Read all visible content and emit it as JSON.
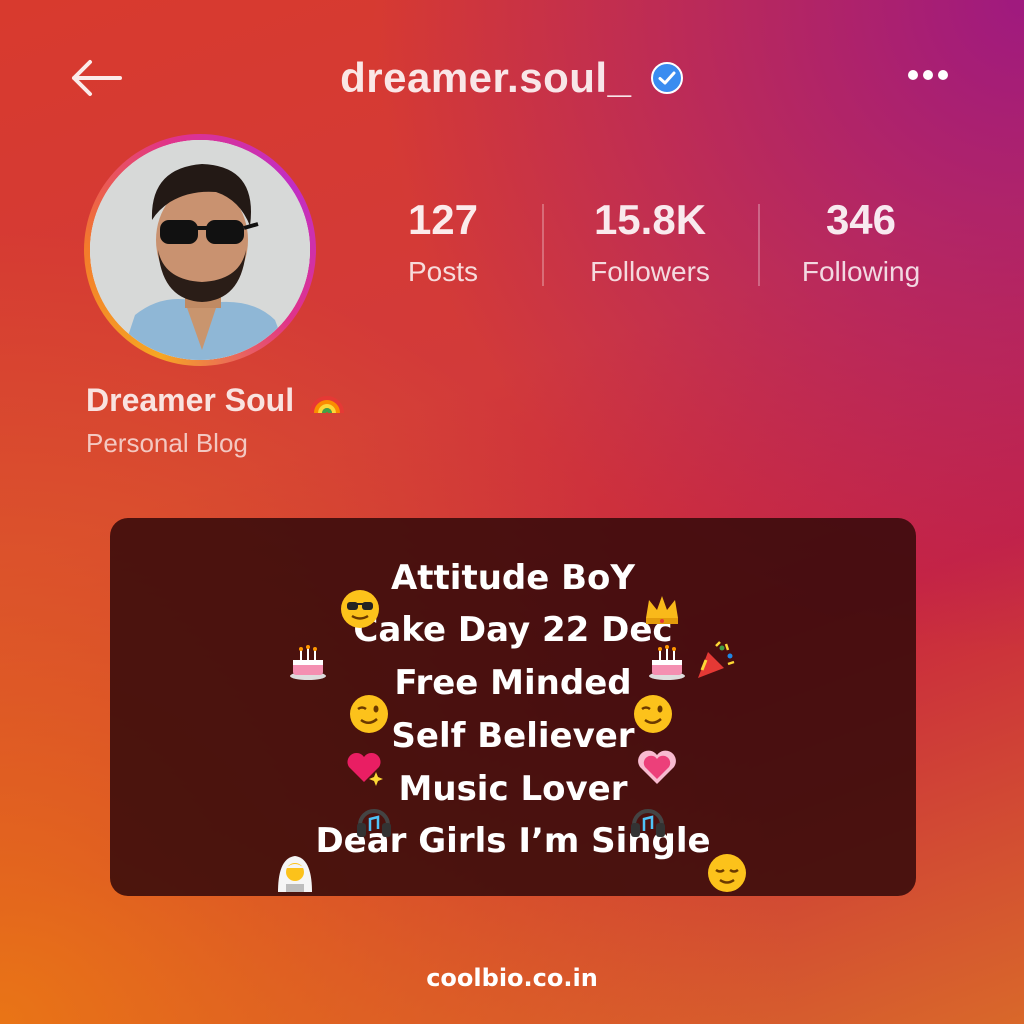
{
  "header": {
    "username": "dreamer.soul_",
    "back_icon": "arrow-left-icon",
    "verified_icon": "verified-badge-icon",
    "more_icon": "more-horizontal-icon"
  },
  "profile": {
    "display_name": "Dreamer Soul",
    "name_emoji": "rainbow-emoji",
    "category": "Personal Blog"
  },
  "stats": [
    {
      "value": "127",
      "label": "Posts"
    },
    {
      "value": "15.8K",
      "label": "Followers"
    },
    {
      "value": "346",
      "label": "Following"
    }
  ],
  "bio": {
    "lines": [
      "Attitude BoY",
      "Cake Day 22 Dec",
      "Free Minded",
      "Self Believer",
      "Music Lover",
      "Dear Girls I’m Single"
    ],
    "emojis": [
      "sunglasses-face-emoji",
      "crown-emoji",
      "birthday-cake-emoji",
      "birthday-cake-emoji",
      "party-popper-emoji",
      "winking-face-emoji",
      "winking-face-emoji",
      "sparkling-heart-emoji",
      "growing-heart-emoji",
      "headphones-emoji",
      "headphones-emoji",
      "person-with-veil-emoji",
      "relieved-face-emoji"
    ]
  },
  "footer": {
    "site": "coolbio.co.in"
  },
  "colors": {
    "accent": "#3a8cf0",
    "card_bg": "#370a0a",
    "gradient_top": "#d83a2e",
    "gradient_corner": "#96148c"
  }
}
